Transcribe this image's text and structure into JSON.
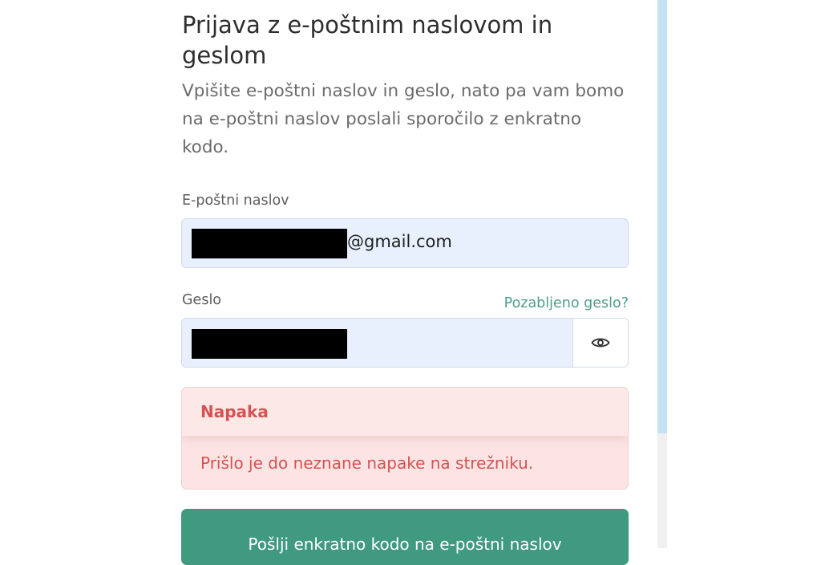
{
  "form": {
    "heading": "Prijava z e-poštnim naslovom in geslom",
    "intro": "Vpišite e-poštni naslov in geslo, nato pa vam bomo na e-poštni naslov poslali sporočilo z enkratno kodo.",
    "email_label": "E-poštni naslov",
    "email_visible_suffix": "@gmail.com",
    "password_label": "Geslo",
    "forgot_password": "Pozabljeno geslo?",
    "submit_label": "Pošlji enkratno kodo na e-poštni naslov"
  },
  "error": {
    "title": "Napaka",
    "message": "Prišlo je do neznane napake na strežniku."
  },
  "icons": {
    "password_toggle": "eye-icon"
  },
  "colors": {
    "accent": "#3f9a7f",
    "link": "#4f9e8a",
    "error": "#d65252",
    "input_bg": "#e8f0fe"
  }
}
